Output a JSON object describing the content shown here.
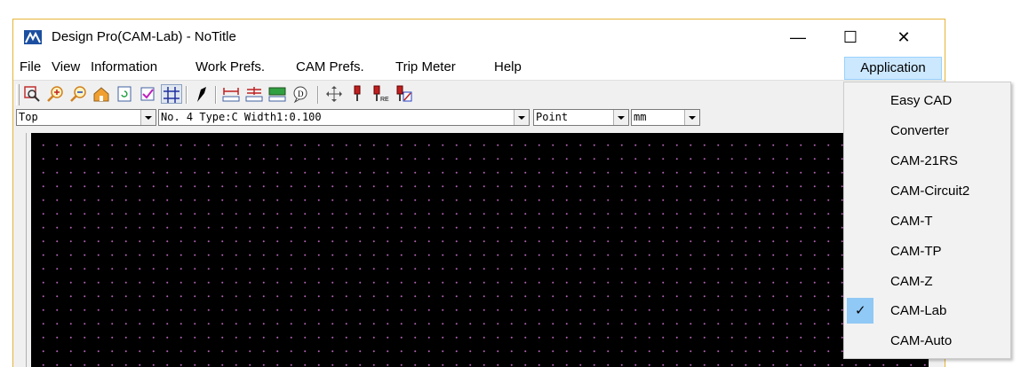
{
  "window": {
    "title": "Design Pro(CAM-Lab) - NoTitle",
    "controls": {
      "minimize": "—",
      "maximize": "☐",
      "close": "✕"
    }
  },
  "menubar": {
    "items": [
      "File",
      "View",
      "Information",
      "Work Prefs.",
      "CAM Prefs.",
      "Trip Meter",
      "Help"
    ],
    "application_label": "Application"
  },
  "toolbar": {
    "buttons": [
      {
        "icon": "zoom-window-icon"
      },
      {
        "icon": "zoom-in-icon"
      },
      {
        "icon": "zoom-out-icon"
      },
      {
        "icon": "home-view-icon"
      },
      {
        "icon": "refresh-icon"
      },
      {
        "icon": "check-icon"
      },
      {
        "icon": "grid-icon",
        "pressed": true
      },
      {
        "icon": "pen-icon"
      },
      {
        "icon": "measure-horizontal-icon"
      },
      {
        "icon": "measure-distance-icon"
      },
      {
        "icon": "measure-area-icon"
      },
      {
        "icon": "info-bubble-icon"
      },
      {
        "icon": "move-icon"
      },
      {
        "icon": "tool-icon"
      },
      {
        "icon": "tool-re-icon"
      },
      {
        "icon": "tool-red-icon"
      }
    ]
  },
  "combos": {
    "layer": "Top",
    "tool": "No.  4 Type:C Width1:0.100",
    "snap": "Point",
    "unit": "mm"
  },
  "application_menu": {
    "items": [
      {
        "label": "Easy CAD",
        "checked": false
      },
      {
        "label": "Converter",
        "checked": false
      },
      {
        "label": "CAM-21RS",
        "checked": false
      },
      {
        "label": "CAM-Circuit2",
        "checked": false
      },
      {
        "label": "CAM-T",
        "checked": false
      },
      {
        "label": "CAM-TP",
        "checked": false
      },
      {
        "label": "CAM-Z",
        "checked": false
      },
      {
        "label": "CAM-Lab",
        "checked": true
      },
      {
        "label": "CAM-Auto",
        "checked": false
      }
    ],
    "check_glyph": "✓"
  },
  "colors": {
    "canvas_bg": "#000000",
    "grid_dot": "#b060b0",
    "menu_highlight": "#cce8ff",
    "check_highlight": "#90c8f6",
    "window_border": "#e6b53a"
  }
}
